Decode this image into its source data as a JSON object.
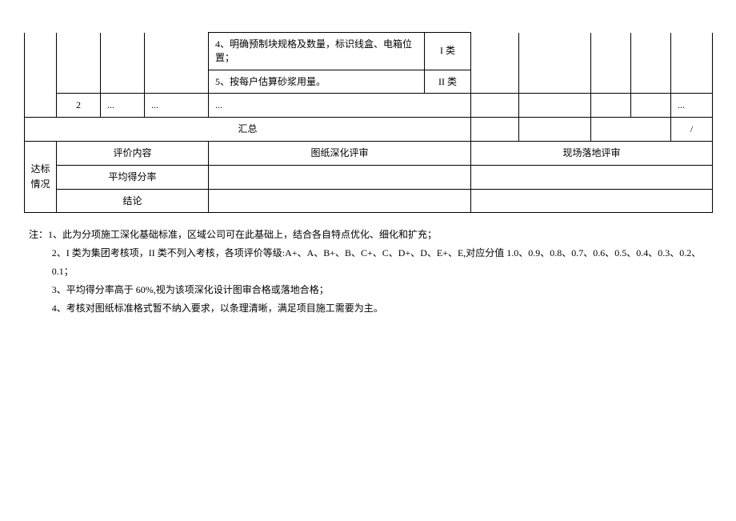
{
  "table": {
    "criteria": [
      {
        "text": "4、明确预制块规格及数量，标识线盒、电箱位置；",
        "class": "I 类"
      },
      {
        "text": "5、按每户估算砂浆用量。",
        "class": "II 类"
      }
    ],
    "row2": {
      "index": "2",
      "dots": "..."
    },
    "summary_label": "汇总",
    "summary_right": "/",
    "standard_label": "达标情况",
    "headers": {
      "eval_content": "评价内容",
      "drawing_review": "图纸深化评审",
      "site_review": "现场落地评审",
      "avg_score": "平均得分率",
      "conclusion": "结论"
    }
  },
  "notes": {
    "prefix": "注：",
    "items": [
      "1、此为分项施工深化基础标准，区域公司可在此基础上，结合各自特点优化、细化和扩充；",
      "2、I 类为集团考核项，II 类不列入考核，各项评价等级:A+、A、B+、B、C+、C、D+、D、E+、E,对应分值 1.0、0.9、0.8、0.7、0.6、0.5、0.4、0.3、0.2、0.1；",
      "3、平均得分率高于 60%,视为该项深化设计图审合格或落地合格；",
      "4、考核对图纸标准格式暂不纳入要求，以条理清晰，满足项目施工需要为主。"
    ]
  }
}
